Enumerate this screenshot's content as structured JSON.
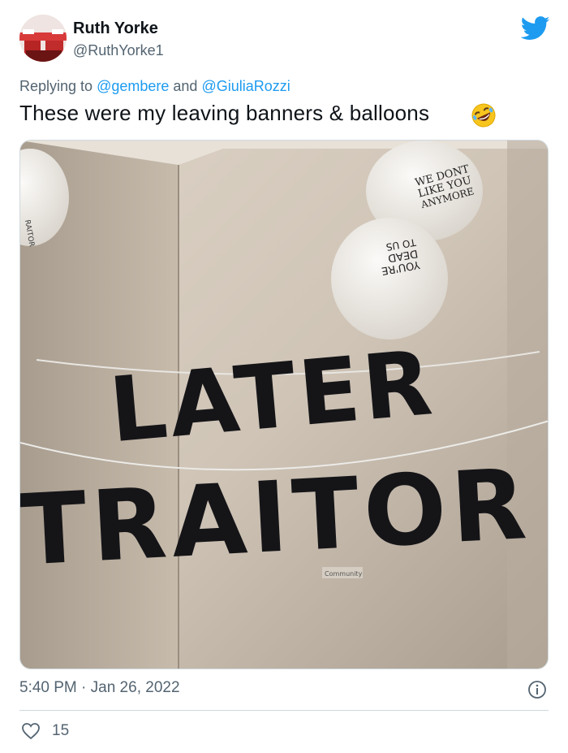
{
  "author": {
    "name": "Ruth Yorke",
    "handle": "@RuthYorke1"
  },
  "reply": {
    "prefix": "Replying to ",
    "mention1": "@gembere",
    "connector": " and ",
    "mention2": "@GiuliaRozzi"
  },
  "tweet": {
    "text": "These were my leaving banners & balloons",
    "emoji": "rolling-on-floor-laughing-emoji"
  },
  "photo": {
    "banner_line1": "LATER",
    "banner_line2": "TRAITOR",
    "balloon1": [
      "WE DONT",
      "LIKE YOU",
      "ANYMORE"
    ],
    "balloon2": [
      "YOU'RE",
      "DEAD",
      "TO US"
    ],
    "balloon_left": "RAITOR",
    "community_sticker": "Community"
  },
  "meta": {
    "timestamp": "5:40 PM · Jan 26, 2022",
    "likes": "15"
  },
  "icons": {
    "brand": "twitter-bird-icon",
    "info": "info-icon",
    "like": "heart-icon"
  },
  "colors": {
    "twitter_blue": "#1d9bf0",
    "secondary_text": "#536471",
    "primary_text": "#0f1419"
  }
}
